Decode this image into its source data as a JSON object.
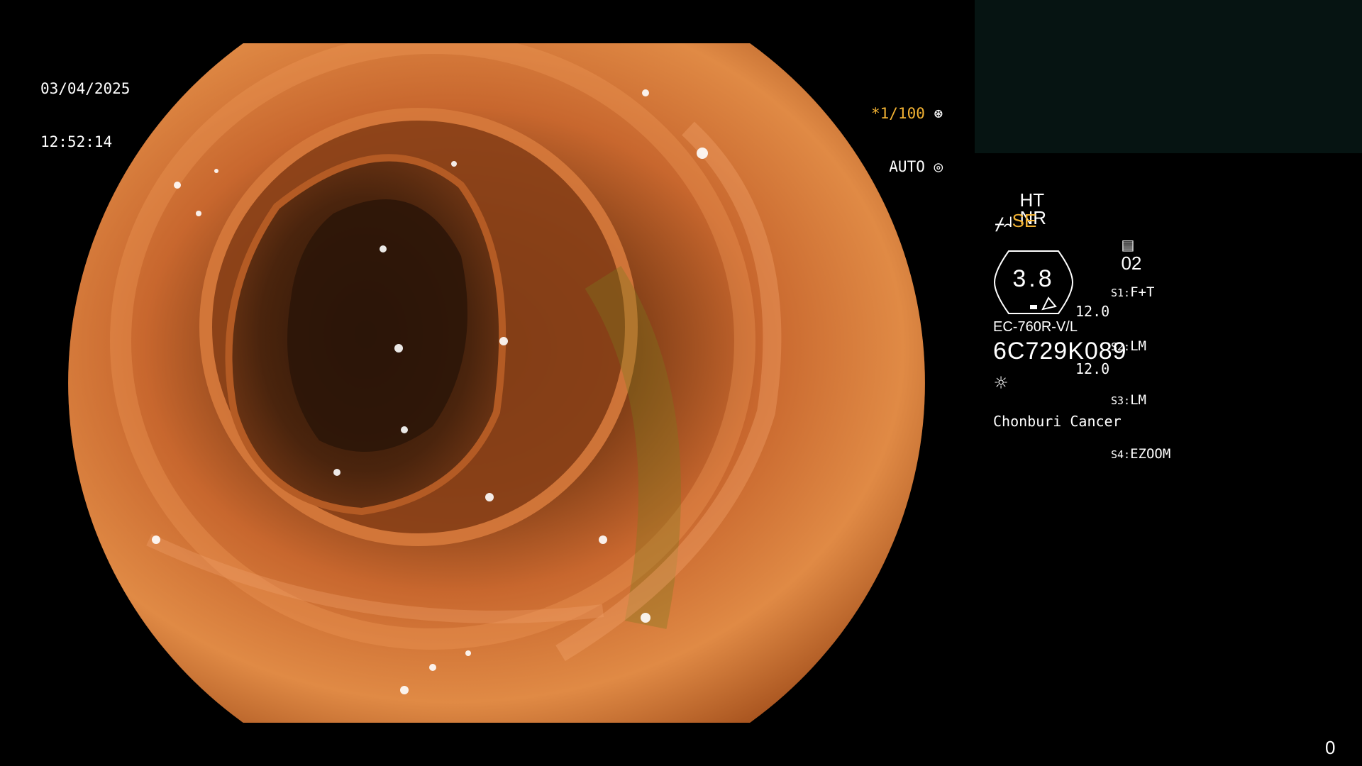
{
  "overlay": {
    "date": "03/04/2025",
    "time": "12:52:14",
    "shutter": "*1/100",
    "exposure_mode": "AUTO",
    "enhancement_ht": "HT",
    "enhancement_nr": "NR",
    "structure_mode": "SE",
    "memory_slot": "02",
    "magnification": "3.8",
    "value_1": "12.0",
    "value_2": "12.0",
    "switch_labels": [
      "S1:",
      "S2:",
      "S3:",
      "S4:"
    ],
    "switch_values": [
      "F+T",
      "LM",
      "LM",
      "EZOOM"
    ],
    "scope_model": "EC-760R-V/L",
    "serial": "6C729K089",
    "institution": "Chonburi Cancer",
    "counter": "0"
  },
  "colors": {
    "accent": "#f2b233",
    "panel": "#061412",
    "background": "#000000"
  },
  "icons": {
    "shutter_icon": "aperture-icon",
    "auto_icon": "iris-icon",
    "scope_icon": "endoscope-icon",
    "se_icon": "wave-icon",
    "memory_icon": "memory-icon",
    "light_icon": "sun-icon"
  }
}
